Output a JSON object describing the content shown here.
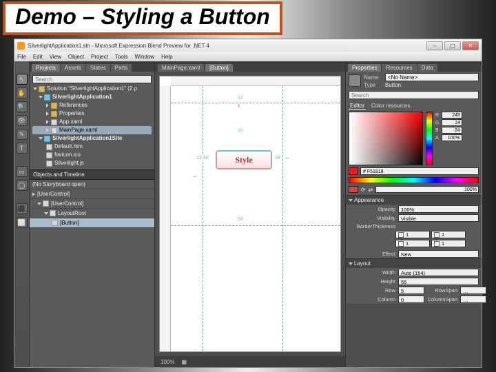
{
  "slide_title": "Demo – Styling a Button",
  "app": {
    "title": "SilverlightApplication1.sln - Microsoft Expression Blend Preview for .NET 4",
    "menu": [
      "File",
      "Edit",
      "View",
      "Object",
      "Project",
      "Tools",
      "Window",
      "Help"
    ],
    "window_buttons": {
      "min": "–",
      "max": "▢",
      "close": "✕"
    }
  },
  "tools": [
    "↖",
    "✋",
    "🔍",
    "👁",
    "✎",
    "T",
    "▭",
    "◯",
    "⬛",
    "⬜"
  ],
  "left": {
    "tabs": [
      "Projects",
      "Assets",
      "States",
      "Parts"
    ],
    "active_tab": "Projects",
    "search_placeholder": "Search",
    "tree": {
      "solution": "Solution \"SilverlightApplication1\" (2 p",
      "proj1": "SilverlightApplication1",
      "refs": "References",
      "props": "Properties",
      "appx": "App.xaml",
      "mainpage": "MainPage.xaml",
      "proj2": "SilverlightApplication1Site",
      "def": "Default.htm",
      "fav": "favicon.ico",
      "slj": "Silverlight.js"
    },
    "objects_header": "Objects and Timeline",
    "storyboard": "(No Storyboard open)",
    "obj_tree": {
      "root": "[UserControl]",
      "uc": "[UserControl]",
      "lr": "LayoutRoot",
      "btn": "[Button]"
    }
  },
  "designer": {
    "tabs": [
      "MainPage.xaml",
      "[Button]"
    ],
    "active_tab": "[Button]",
    "button_label": "Style",
    "margins": {
      "top": "25",
      "left": "40",
      "right": "38",
      "bottom": "50",
      "l_anchor": "13",
      "t_anchor": "12"
    },
    "footer_zoom": "100%"
  },
  "right": {
    "tabs": [
      "Properties",
      "Resources",
      "Data"
    ],
    "active_tab": "Properties",
    "name_label": "Name",
    "name_value": "<No Name>",
    "type_label": "Type",
    "type_value": "Button",
    "search_placeholder": "Search",
    "brush_tabs": {
      "editor": "Editor",
      "res": "Color resources"
    },
    "rgba": {
      "R": "245",
      "G": "24",
      "B": "24",
      "A": "100%"
    },
    "hex": "# F51818",
    "opacity_stop": "100%",
    "appearance": {
      "header": "Appearance",
      "opacity_l": "Opacity",
      "opacity_v": "100%",
      "vis_l": "Visibility",
      "vis_v": "Visible",
      "bt_l": "BorderThickness",
      "t1": "1",
      "t2": "1",
      "t3": "1",
      "t4": "1",
      "eff_l": "Effect",
      "eff_v": "New"
    },
    "layout": {
      "header": "Layout",
      "w_l": "Width",
      "w_v": "Auto (154)",
      "h_l": "Height",
      "h_v": "55",
      "row_l": "Row",
      "row_v": "5",
      "rs_l": "RowSpan",
      "rs_v": "…",
      "col_l": "Column",
      "col_v": "0",
      "cs_l": "ColumnSpan",
      "cs_v": "…"
    }
  }
}
